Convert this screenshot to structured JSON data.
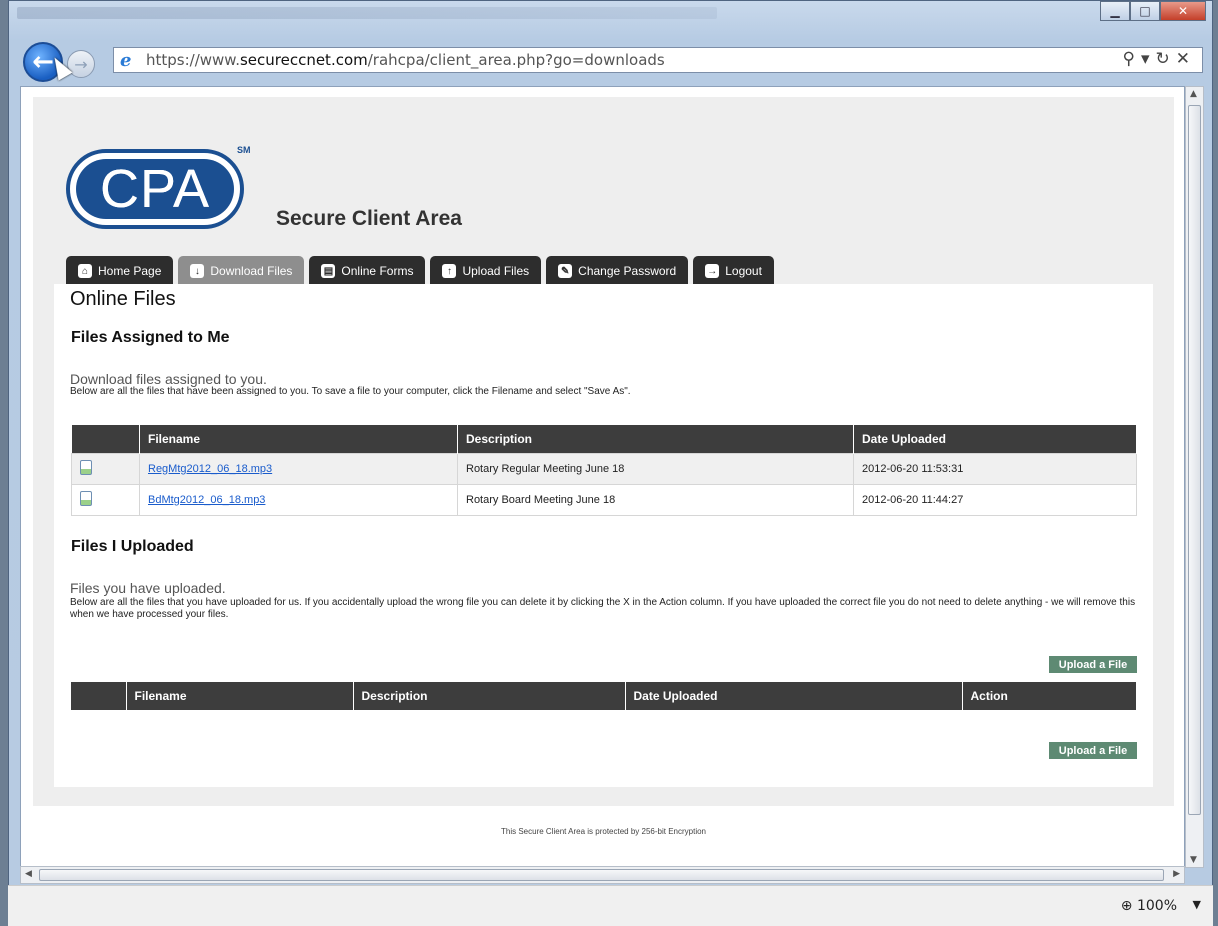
{
  "browser": {
    "url_prefix": "https://www.",
    "url_domain": "secureccnet.com",
    "url_path": "/rahcpa/client_area.php?go=downloads",
    "zoom": "100%"
  },
  "site": {
    "logo_text": "CPA",
    "logo_mark": "SM",
    "title": "Secure Client Area"
  },
  "tabs": [
    {
      "label": "Home Page",
      "icon": "home-icon"
    },
    {
      "label": "Download Files",
      "icon": "download-icon"
    },
    {
      "label": "Online Forms",
      "icon": "forms-icon"
    },
    {
      "label": "Upload Files",
      "icon": "upload-icon"
    },
    {
      "label": "Change Password",
      "icon": "key-icon"
    },
    {
      "label": "Logout",
      "icon": "logout-icon"
    }
  ],
  "content": {
    "heading": "Online Files",
    "assigned": {
      "title": "Files Assigned to Me",
      "subtitle": "Download files assigned to you.",
      "note": "Below are all the files that have been assigned to you. To save a file to your computer, click the Filename and select \"Save As\".",
      "columns": [
        "",
        "Filename",
        "Description",
        "Date Uploaded"
      ],
      "rows": [
        {
          "filename": "RegMtg2012_06_18.mp3",
          "description": "Rotary Regular Meeting June 18",
          "date": "2012-06-20 11:53:31"
        },
        {
          "filename": "BdMtg2012_06_18.mp3",
          "description": "Rotary Board Meeting June 18",
          "date": "2012-06-20 11:44:27"
        }
      ]
    },
    "uploaded": {
      "title": "Files I Uploaded",
      "subtitle": "Files you have uploaded.",
      "note": "Below are all the files that you have uploaded for us. If you accidentally upload the wrong file you can delete it by clicking the X in the Action column. If you have uploaded the correct file you do not need to delete anything - we will remove this when we have processed your files.",
      "columns": [
        "",
        "Filename",
        "Description",
        "Date Uploaded",
        "Action"
      ],
      "upload_label": "Upload a File"
    }
  },
  "footer": "This Secure Client Area is protected by 256-bit Encryption"
}
